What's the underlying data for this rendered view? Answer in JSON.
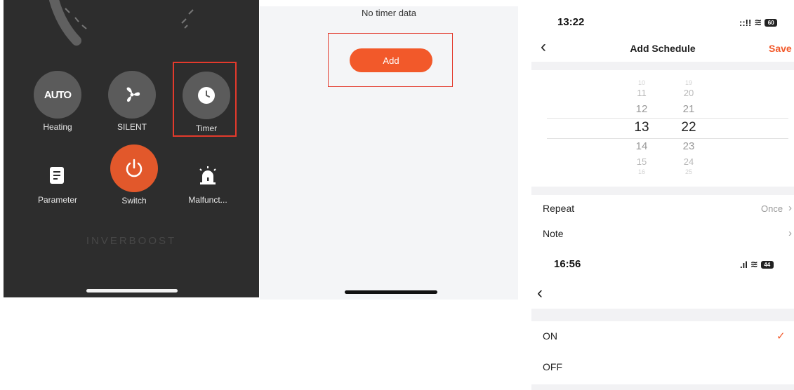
{
  "control_panel": {
    "buttons": [
      {
        "label": "Heating",
        "icon_text": "AUTO",
        "icon": "auto-mode-icon"
      },
      {
        "label": "SILENT",
        "icon": "fan-icon"
      },
      {
        "label": "Timer",
        "icon": "clock-icon"
      },
      {
        "label": "Parameter",
        "icon": "document-icon"
      },
      {
        "label": "Switch",
        "icon": "power-icon"
      },
      {
        "label": "Malfunct...",
        "icon": "alarm-icon"
      }
    ],
    "brand": "INVERBOOST",
    "accent_color": "#e2582b",
    "highlight_color": "#e33a2c"
  },
  "timer_list": {
    "empty_text": "No timer data",
    "add_label": "Add",
    "accent_color": "#f2592a"
  },
  "schedule": {
    "status_time": "13:22",
    "battery": "60",
    "title": "Add Schedule",
    "save_label": "Save",
    "back_glyph": "‹",
    "hours": [
      "10",
      "11",
      "12",
      "13",
      "14",
      "15",
      "16"
    ],
    "minutes": [
      "19",
      "20",
      "21",
      "22",
      "23",
      "24",
      "25"
    ],
    "repeat_label": "Repeat",
    "repeat_value": "Once",
    "note_label": "Note",
    "save_color": "#f2592a"
  },
  "onoff": {
    "status_time": "16:56",
    "battery": "44",
    "options": [
      {
        "label": "ON",
        "selected": true
      },
      {
        "label": "OFF",
        "selected": false
      }
    ],
    "check_glyph": "✓",
    "check_color": "#f2592a"
  }
}
